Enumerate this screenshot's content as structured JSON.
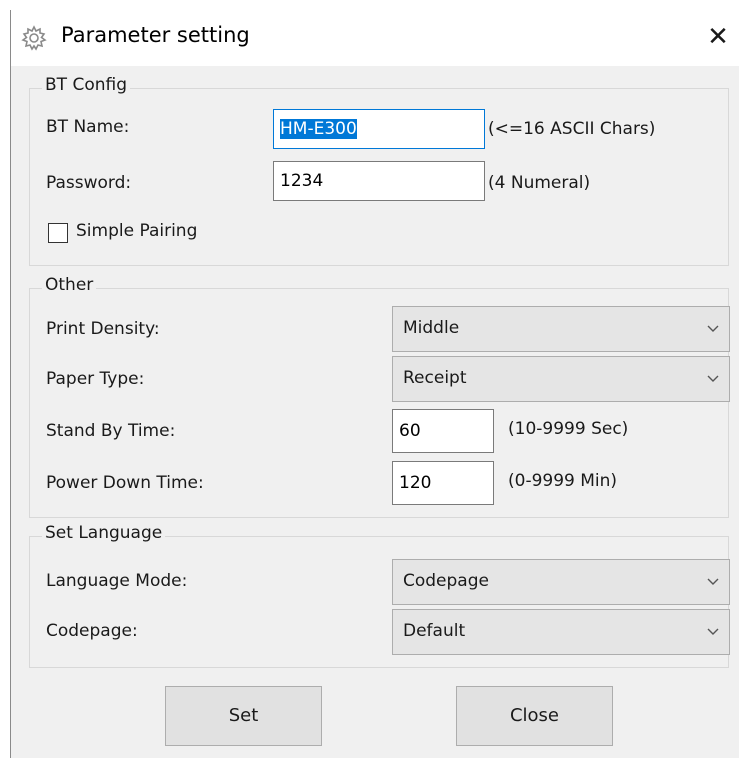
{
  "window": {
    "title": "Parameter setting",
    "close_glyph": "✕",
    "title_icon": "gear-icon"
  },
  "bt_config": {
    "group_label": "BT Config",
    "bt_name_label": "BT Name:",
    "bt_name_value": "HM-E300",
    "bt_name_hint": "(<=16 ASCII Chars)",
    "password_label": "Password:",
    "password_value": "1234",
    "password_hint": "(4 Numeral)",
    "simple_pairing_label": "Simple Pairing",
    "simple_pairing_checked": false
  },
  "other": {
    "group_label": "Other",
    "print_density_label": "Print Density:",
    "print_density_value": "Middle",
    "paper_type_label": "Paper Type:",
    "paper_type_value": "Receipt",
    "standby_label": "Stand By Time:",
    "standby_value": "60",
    "standby_hint": "(10-9999 Sec)",
    "power_down_label": "Power Down Time:",
    "power_down_value": "120",
    "power_down_hint": "(0-9999 Min)"
  },
  "language": {
    "group_label": "Set Language",
    "mode_label": "Language Mode:",
    "mode_value": "Codepage",
    "codepage_label": "Codepage:",
    "codepage_value": "Default"
  },
  "buttons": {
    "set_label": "Set",
    "close_label": "Close"
  }
}
